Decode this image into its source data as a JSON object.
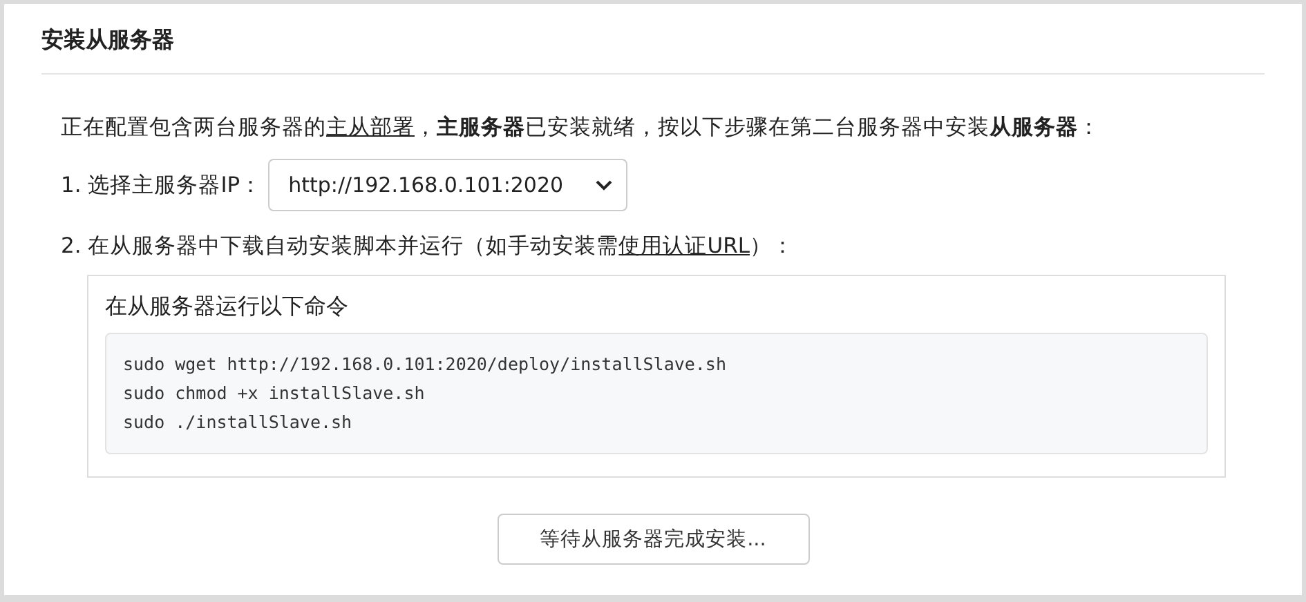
{
  "title": "安装从服务器",
  "intro": [
    {
      "kind": "text",
      "text": "正在配置包含两台服务器的"
    },
    {
      "kind": "link",
      "text": "主从部署"
    },
    {
      "kind": "text",
      "text": "，"
    },
    {
      "kind": "bold",
      "text": "主服务器"
    },
    {
      "kind": "text",
      "text": "已安装就绪，按以下步骤在第二台服务器中安装"
    },
    {
      "kind": "bold",
      "text": "从服务器"
    },
    {
      "kind": "text",
      "text": "："
    }
  ],
  "step1": {
    "label": "1. 选择主服务器IP：",
    "select_value": "http://192.168.0.101:2020"
  },
  "step2": [
    {
      "kind": "text",
      "text": "2. 在从服务器中下载自动安装脚本并运行（如手动安装需"
    },
    {
      "kind": "link",
      "text": "使用认证URL"
    },
    {
      "kind": "text",
      "text": "）："
    }
  ],
  "command_panel": {
    "title": "在从服务器运行以下命令",
    "lines": [
      "sudo wget http://192.168.0.101:2020/deploy/installSlave.sh",
      "sudo chmod +x installSlave.sh",
      "sudo ./installSlave.sh"
    ]
  },
  "wait_button": {
    "label": "等待从服务器完成安装...",
    "disabled": false
  }
}
